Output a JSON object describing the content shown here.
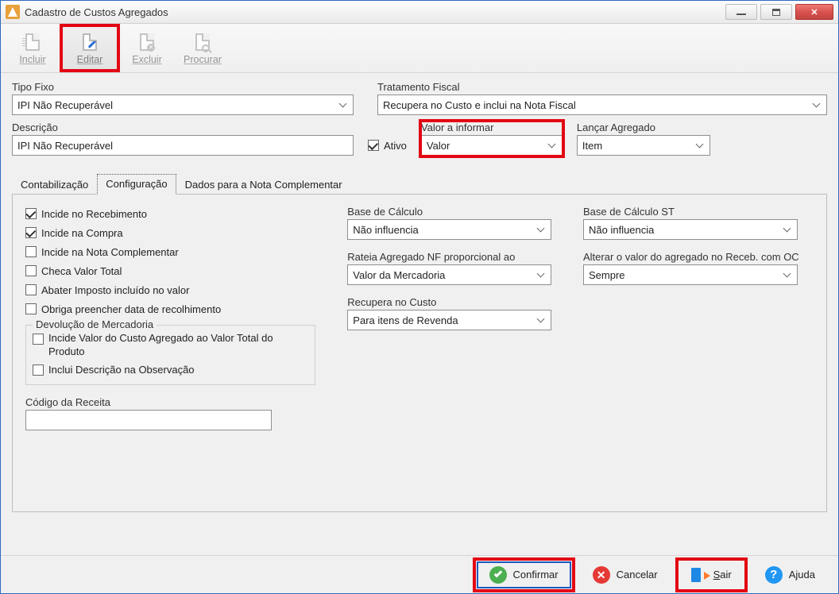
{
  "window": {
    "title": "Cadastro de Custos Agregados"
  },
  "toolbar": {
    "incluir": "Incluir",
    "editar": "Editar",
    "excluir": "Excluir",
    "procurar": "Procurar"
  },
  "fields": {
    "tipo_fixo_label": "Tipo Fixo",
    "tipo_fixo_value": "IPI Não Recuperável",
    "tratamento_label": "Tratamento Fiscal",
    "tratamento_value": "Recupera no Custo e inclui na Nota Fiscal",
    "descricao_label": "Descrição",
    "descricao_value": "IPI Não Recuperável",
    "ativo_label": "Ativo",
    "valor_informar_label": "Valor a informar",
    "valor_informar_value": "Valor",
    "lancar_agregado_label": "Lançar Agregado",
    "lancar_agregado_value": "Item"
  },
  "tabs": {
    "contabilizacao": "Contabilização",
    "configuracao": "Configuração",
    "dados_nc": "Dados para a Nota Complementar"
  },
  "config": {
    "chk_incide_recebimento": "Incide no Recebimento",
    "chk_incide_compra": "Incide na Compra",
    "chk_incide_nc": "Incide na Nota Complementar",
    "chk_checa_valor": "Checa Valor Total",
    "chk_abater_imposto": "Abater Imposto incluído no valor",
    "chk_obriga_data": "Obriga preencher data de recolhimento",
    "grp_devolucao": "Devolução de Mercadoria",
    "chk_incide_valor_total": "Incide Valor do Custo Agregado ao Valor Total do Produto",
    "chk_inclui_desc_obs": "Inclui Descrição na Observação",
    "codigo_receita_label": "Código da Receita",
    "codigo_receita_value": "",
    "base_calculo_label": "Base de Cálculo",
    "base_calculo_value": "Não influencia",
    "rateia_label": "Rateia Agregado NF proporcional ao",
    "rateia_value": "Valor da Mercadoria",
    "recupera_label": "Recupera no Custo",
    "recupera_value": "Para itens de Revenda",
    "base_st_label": "Base de Cálculo ST",
    "base_st_value": "Não influencia",
    "alterar_label": "Alterar o valor do agregado no Receb. com OC",
    "alterar_value": "Sempre"
  },
  "footer": {
    "confirmar": "Confirmar",
    "cancelar": "Cancelar",
    "sair": "Sair",
    "ajuda": "Ajuda"
  }
}
